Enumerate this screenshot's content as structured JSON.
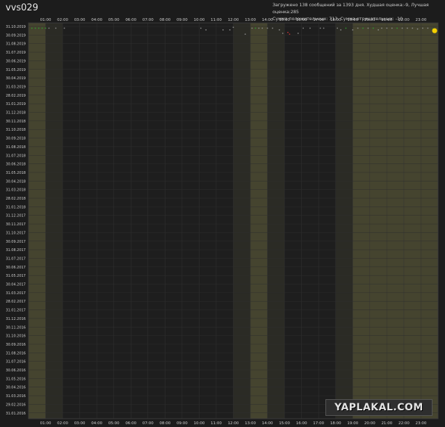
{
  "header": {
    "username": "vvs029",
    "info_line1": "Загружено 138 сообщений за 1393 дня. Худшая оценка:-9, Лучшая оценка:285",
    "info_line2": "Сумма положительных: 713, Сумма отрицательных: -10"
  },
  "watermark": "YAPLAKAL.COM",
  "colors": {
    "background": "#1c1c1c",
    "plot_dark": "#1e1e1e",
    "band_mid": "#2b2b25",
    "band_light": "#45442f",
    "dot_neutral": "#8a8a8a",
    "dot_positive": "#2e9a2e",
    "dot_negative": "#c43131",
    "dot_best": "#f5d000"
  },
  "chart_data": {
    "type": "scatter",
    "x_axis": {
      "unit": "hour of day",
      "range": [
        0,
        24
      ],
      "tick_labels": [
        "01:00",
        "02:00",
        "03:00",
        "04:00",
        "05:00",
        "06:00",
        "07:00",
        "08:00",
        "09:00",
        "10:00",
        "11:00",
        "12:00",
        "13:00",
        "14:00",
        "15:00",
        "16:00",
        "17:00",
        "18:00",
        "19:00",
        "20:00",
        "21:00",
        "22:00",
        "23:00"
      ],
      "position": "top and bottom"
    },
    "y_axis": {
      "tick_labels": [
        "31.10.2019",
        "30.09.2019",
        "31.08.2019",
        "31.07.2019",
        "30.06.2019",
        "31.05.2019",
        "30.04.2019",
        "31.03.2019",
        "28.02.2019",
        "31.01.2019",
        "31.12.2018",
        "30.11.2018",
        "31.10.2018",
        "30.09.2018",
        "31.08.2018",
        "31.07.2018",
        "30.06.2018",
        "31.05.2018",
        "30.04.2018",
        "31.03.2018",
        "28.02.2018",
        "31.01.2018",
        "31.12.2017",
        "30.11.2017",
        "31.10.2017",
        "30.09.2017",
        "31.08.2017",
        "31.07.2017",
        "30.06.2017",
        "31.05.2017",
        "30.04.2017",
        "31.03.2017",
        "28.02.2017",
        "31.01.2017",
        "31.12.2016",
        "30.11.2016",
        "31.10.2016",
        "30.09.2016",
        "31.08.2016",
        "31.07.2016",
        "30.06.2016",
        "31.05.2016",
        "30.04.2016",
        "31.03.2016",
        "29.02.2016",
        "31.01.2016"
      ],
      "order": "newest at top"
    },
    "background_bands": [
      {
        "from": 0.0,
        "to": 1.0,
        "shade": "light"
      },
      {
        "from": 1.0,
        "to": 2.0,
        "shade": "mid"
      },
      {
        "from": 12.0,
        "to": 13.0,
        "shade": "mid"
      },
      {
        "from": 13.0,
        "to": 14.0,
        "shade": "light"
      },
      {
        "from": 14.0,
        "to": 15.0,
        "shade": "mid"
      },
      {
        "from": 18.0,
        "to": 19.0,
        "shade": "mid"
      },
      {
        "from": 19.0,
        "to": 24.0,
        "shade": "light"
      }
    ],
    "grid": true,
    "points": [
      {
        "hour": 0.2,
        "month": 0.2,
        "kind": "positive"
      },
      {
        "hour": 0.4,
        "month": 0.2,
        "kind": "positive"
      },
      {
        "hour": 0.6,
        "month": 0.2,
        "kind": "positive"
      },
      {
        "hour": 0.8,
        "month": 0.2,
        "kind": "positive"
      },
      {
        "hour": 1.0,
        "month": 0.2,
        "kind": "positive"
      },
      {
        "hour": 1.2,
        "month": 0.2,
        "kind": "neutral"
      },
      {
        "hour": 1.6,
        "month": 0.2,
        "kind": "neutral"
      },
      {
        "hour": 2.1,
        "month": 0.2,
        "kind": "neutral"
      },
      {
        "hour": 10.1,
        "month": 0.2,
        "kind": "neutral"
      },
      {
        "hour": 10.4,
        "month": 0.4,
        "kind": "neutral"
      },
      {
        "hour": 11.4,
        "month": 0.4,
        "kind": "neutral"
      },
      {
        "hour": 11.8,
        "month": 0.4,
        "kind": "neutral"
      },
      {
        "hour": 12.0,
        "month": 0.1,
        "kind": "neutral"
      },
      {
        "hour": 12.7,
        "month": 0.9,
        "kind": "neutral"
      },
      {
        "hour": 13.1,
        "month": 0.2,
        "kind": "neutral"
      },
      {
        "hour": 13.3,
        "month": 0.2,
        "kind": "positive"
      },
      {
        "hour": 13.5,
        "month": 0.2,
        "kind": "neutral"
      },
      {
        "hour": 13.7,
        "month": 0.2,
        "kind": "neutral"
      },
      {
        "hour": 14.0,
        "month": 0.2,
        "kind": "neutral"
      },
      {
        "hour": 14.3,
        "month": 0.2,
        "kind": "neutral"
      },
      {
        "hour": 14.7,
        "month": 0.4,
        "kind": "neutral"
      },
      {
        "hour": 14.9,
        "month": 0.8,
        "kind": "neutral"
      },
      {
        "hour": 15.2,
        "month": 0.7,
        "kind": "negative"
      },
      {
        "hour": 15.3,
        "month": 0.9,
        "kind": "negative"
      },
      {
        "hour": 15.8,
        "month": 0.8,
        "kind": "neutral"
      },
      {
        "hour": 16.1,
        "month": 0.2,
        "kind": "neutral"
      },
      {
        "hour": 16.5,
        "month": 0.2,
        "kind": "neutral"
      },
      {
        "hour": 17.1,
        "month": 0.2,
        "kind": "neutral"
      },
      {
        "hour": 17.3,
        "month": 0.2,
        "kind": "neutral"
      },
      {
        "hour": 18.1,
        "month": 0.2,
        "kind": "neutral"
      },
      {
        "hour": 18.3,
        "month": 0.4,
        "kind": "neutral"
      },
      {
        "hour": 18.6,
        "month": 0.2,
        "kind": "positive"
      },
      {
        "hour": 19.0,
        "month": 0.4,
        "kind": "neutral"
      },
      {
        "hour": 19.3,
        "month": 0.2,
        "kind": "neutral"
      },
      {
        "hour": 19.6,
        "month": 0.2,
        "kind": "positive"
      },
      {
        "hour": 19.9,
        "month": 0.2,
        "kind": "neutral"
      },
      {
        "hour": 20.2,
        "month": 0.2,
        "kind": "positive"
      },
      {
        "hour": 20.5,
        "month": 0.4,
        "kind": "neutral"
      },
      {
        "hour": 20.7,
        "month": 0.2,
        "kind": "neutral"
      },
      {
        "hour": 21.0,
        "month": 0.2,
        "kind": "neutral"
      },
      {
        "hour": 21.3,
        "month": 0.2,
        "kind": "neutral"
      },
      {
        "hour": 21.6,
        "month": 0.2,
        "kind": "positive"
      },
      {
        "hour": 21.9,
        "month": 0.2,
        "kind": "neutral"
      },
      {
        "hour": 22.2,
        "month": 0.2,
        "kind": "neutral"
      },
      {
        "hour": 22.5,
        "month": 0.2,
        "kind": "neutral"
      },
      {
        "hour": 22.8,
        "month": 0.3,
        "kind": "neutral"
      },
      {
        "hour": 23.1,
        "month": 0.2,
        "kind": "neutral"
      },
      {
        "hour": 23.4,
        "month": 0.2,
        "kind": "neutral"
      },
      {
        "hour": 23.7,
        "month": 0.3,
        "kind": "positive"
      },
      {
        "hour": 23.8,
        "month": 0.5,
        "kind": "best"
      }
    ]
  }
}
